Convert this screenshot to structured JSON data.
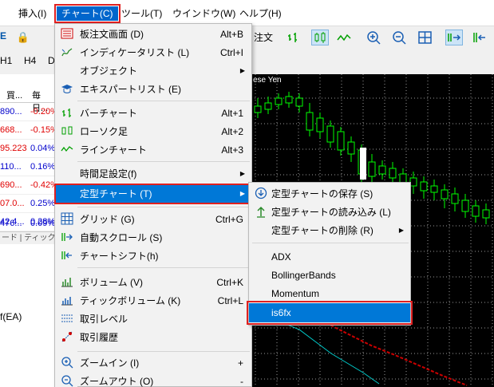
{
  "menubar": {
    "items": [
      {
        "label": "挿入(I)"
      },
      {
        "label": "チャート(C)"
      },
      {
        "label": "ツール(T)"
      },
      {
        "label": "ウインドウ(W)"
      },
      {
        "label": "ヘルプ(H)"
      }
    ]
  },
  "toolbar": {
    "left_letter": "E",
    "new_order_fragment": "注文",
    "timeframes": [
      "H1",
      "H4",
      "D"
    ]
  },
  "market_watch": {
    "headers": [
      "買...",
      "毎日..."
    ],
    "rows": [
      {
        "bid": "890...",
        "change": "-0.20%"
      },
      {
        "bid": "668...",
        "change": "-0.15%"
      },
      {
        "bid": "95.223",
        "change": "0.04%"
      },
      {
        "bid": "110...",
        "change": "0.16%"
      },
      {
        "bid": "690...",
        "change": "-0.42%"
      },
      {
        "bid": "07.0...",
        "change": "0.25%"
      },
      {
        "bid": "42.4...",
        "change": "0.28%"
      },
      {
        "bid": "476...",
        "change": "0.09%"
      }
    ],
    "tabs_text": "ード | ティック",
    "ea_label": "f(EA)"
  },
  "chart": {
    "title": "ese Yen"
  },
  "chart_menu": {
    "items": [
      {
        "label": "板注文画面 (D)",
        "shortcut": "Alt+B",
        "icon": "depth-of-market-icon"
      },
      {
        "label": "インディケータリスト (L)",
        "shortcut": "Ctrl+I",
        "icon": "indicators-icon"
      },
      {
        "label": "オブジェクト",
        "shortcut": "",
        "icon": ""
      },
      {
        "label": "エキスパートリスト (E)",
        "shortcut": "",
        "icon": "experts-icon"
      },
      {
        "label": "バーチャート",
        "shortcut": "Alt+1",
        "icon": "bar-chart-icon"
      },
      {
        "label": "ローソク足",
        "shortcut": "Alt+2",
        "icon": "candlestick-icon"
      },
      {
        "label": "ラインチャート",
        "shortcut": "Alt+3",
        "icon": "line-chart-icon"
      },
      {
        "label": "時間足設定(f)",
        "shortcut": "",
        "icon": ""
      },
      {
        "label": "定型チャート (T)",
        "shortcut": "",
        "icon": ""
      },
      {
        "label": "グリッド (G)",
        "shortcut": "Ctrl+G",
        "icon": "grid-icon"
      },
      {
        "label": "自動スクロール (S)",
        "shortcut": "",
        "icon": "auto-scroll-icon"
      },
      {
        "label": "チャートシフト(h)",
        "shortcut": "",
        "icon": "chart-shift-icon"
      },
      {
        "label": "ボリューム (V)",
        "shortcut": "Ctrl+K",
        "icon": "volume-icon"
      },
      {
        "label": "ティックボリューム (K)",
        "shortcut": "Ctrl+L",
        "icon": "tick-volume-icon"
      },
      {
        "label": "取引レベル",
        "shortcut": "",
        "icon": "trade-levels-icon"
      },
      {
        "label": "取引履歴",
        "shortcut": "",
        "icon": "trade-history-icon"
      },
      {
        "label": "ズームイン (I)",
        "shortcut": "+",
        "icon": "zoom-in-icon"
      },
      {
        "label": "ズームアウト (O)",
        "shortcut": "-",
        "icon": "zoom-out-icon"
      }
    ]
  },
  "template_menu": {
    "items": [
      {
        "label": "定型チャートの保存 (S)",
        "icon": "save-template-icon"
      },
      {
        "label": "定型チャートの読み込み (L)",
        "icon": "load-template-icon"
      },
      {
        "label": "定型チャートの削除 (R)",
        "icon": ""
      },
      {
        "label": "ADX",
        "icon": ""
      },
      {
        "label": "BollingerBands",
        "icon": ""
      },
      {
        "label": "Momentum",
        "icon": ""
      },
      {
        "label": "is6fx",
        "icon": ""
      }
    ]
  },
  "colors": {
    "accent": "#0078d7",
    "highlight_border": "#e02020",
    "candle_up": "#00cc00",
    "chart_bg": "#000000"
  }
}
